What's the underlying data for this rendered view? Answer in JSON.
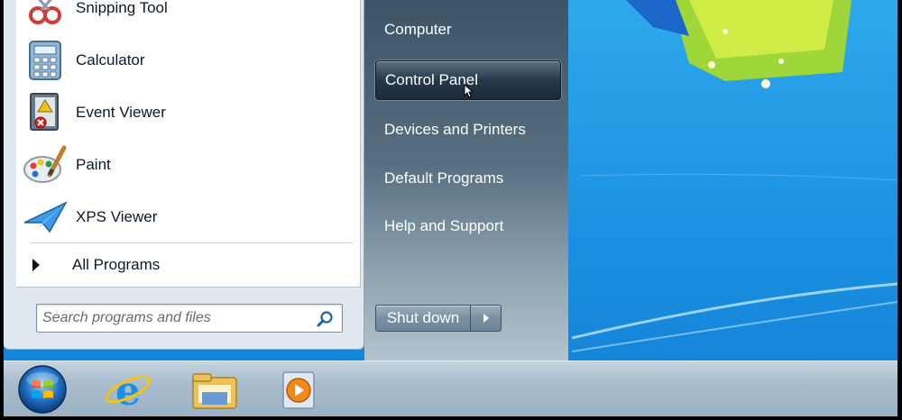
{
  "left_pane": {
    "programs": [
      {
        "label": "Snipping Tool",
        "icon": "snipping-tool-icon"
      },
      {
        "label": "Calculator",
        "icon": "calculator-icon"
      },
      {
        "label": "Event Viewer",
        "icon": "event-viewer-icon"
      },
      {
        "label": "Paint",
        "icon": "paint-icon"
      },
      {
        "label": "XPS Viewer",
        "icon": "xps-viewer-icon"
      }
    ],
    "all_programs_label": "All Programs",
    "search_placeholder": "Search programs and files"
  },
  "right_pane": {
    "items": [
      {
        "label": "Computer"
      },
      {
        "label": "Control Panel",
        "state": "hovered"
      },
      {
        "label": "Devices and Printers"
      },
      {
        "label": "Default Programs"
      },
      {
        "label": "Help and Support"
      }
    ],
    "shutdown_label": "Shut down"
  },
  "taskbar": {
    "items": [
      {
        "icon": "start-orb-icon"
      },
      {
        "icon": "internet-explorer-icon"
      },
      {
        "icon": "windows-explorer-icon"
      },
      {
        "icon": "media-player-icon"
      }
    ]
  },
  "colors": {
    "desktop_blue": "#1e94e3",
    "menu_dark": "#3c5466",
    "taskbar": "#a9bccc"
  }
}
